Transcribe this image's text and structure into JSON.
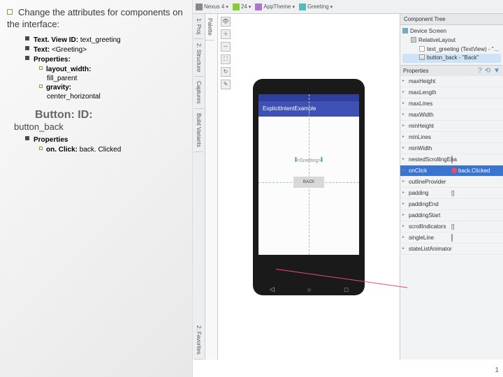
{
  "slide": {
    "main_bullet": "Change the attributes for components on the interface:",
    "tv_id_label": "Text. View ID:",
    "tv_id_value": "text_greeting",
    "text_label": "Text:",
    "text_value": "<Greeting>",
    "props_label": "Properties:",
    "lw_label": "layout_width:",
    "lw_value": "fill_parent",
    "gravity_label": "gravity:",
    "gravity_value": "center_horizontal",
    "button_heading": "Button: ID:",
    "button_id": "button_back",
    "btn_props_label": "Properties",
    "onclick_label": "on. Click:",
    "onclick_value": "back. Clicked",
    "page_number": "1"
  },
  "toolbar": {
    "device": "Nexus 4",
    "api": "24",
    "theme": "AppTheme",
    "activity": "Greeting"
  },
  "side_tabs": {
    "project": "1: Proj",
    "structure": "2: Structure",
    "captures": "Captures",
    "variants": "Build Variants",
    "favorites": "2: Favorites",
    "palette": "Palette"
  },
  "phone": {
    "app_title": "ExplicitIntentExample",
    "greeting_text": "<Greeting>",
    "back_label": "BACK",
    "nav_back": "◁",
    "nav_home": "○",
    "nav_recent": "□"
  },
  "tree": {
    "panel_title": "Component Tree",
    "device": "Device Screen",
    "layout": "RelativeLayout",
    "text_view": "text_greeting (TextView) - \"<G",
    "button": "button_back - \"Back\""
  },
  "props": {
    "title": "Properties",
    "rows": [
      {
        "name": "maxHeight",
        "val": ""
      },
      {
        "name": "maxLength",
        "val": ""
      },
      {
        "name": "maxLines",
        "val": ""
      },
      {
        "name": "maxWidth",
        "val": ""
      },
      {
        "name": "minHeight",
        "val": ""
      },
      {
        "name": "minLines",
        "val": ""
      },
      {
        "name": "minWidth",
        "val": ""
      },
      {
        "name": "nestedScrollingEna",
        "val": "",
        "check": true
      },
      {
        "name": "onClick",
        "val": "back.Clicked",
        "sel": true,
        "chip": true
      },
      {
        "name": "outlineProvider",
        "val": ""
      },
      {
        "name": "padding",
        "val": "[]"
      },
      {
        "name": "paddingEnd",
        "val": ""
      },
      {
        "name": "paddingStart",
        "val": ""
      },
      {
        "name": "scrollIndicators",
        "val": "[]"
      },
      {
        "name": "singleLine",
        "val": "",
        "check": true
      },
      {
        "name": "stateListAnimator",
        "val": ""
      }
    ]
  }
}
